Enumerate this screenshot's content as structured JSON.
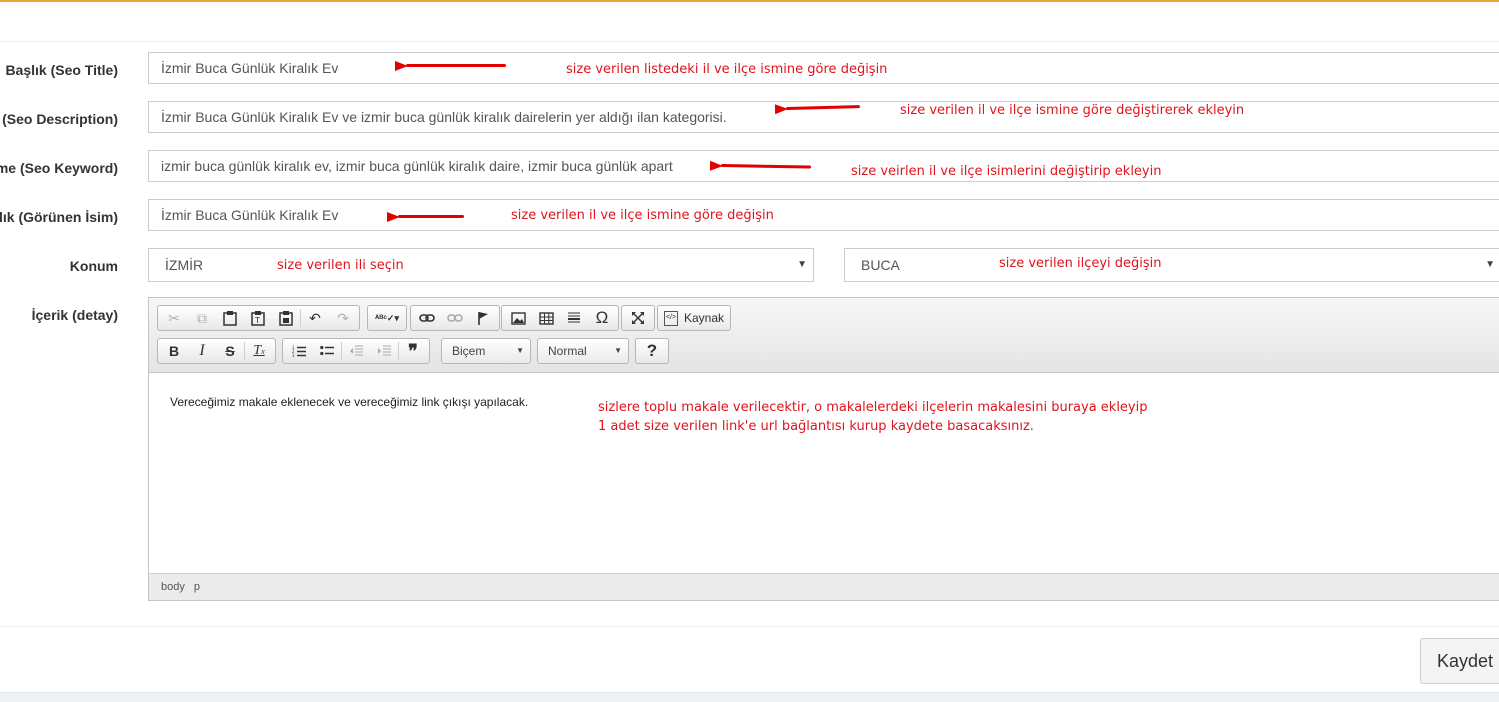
{
  "fields": {
    "seo_title": {
      "label": "Başlık (Seo Title)",
      "value": "İzmir Buca Günlük Kiralık Ev",
      "note": "size verilen listedeki il ve ilçe ismine göre değişin"
    },
    "seo_description": {
      "label": "(Seo Description)",
      "value": "İzmir Buca Günlük Kiralık Ev ve izmir buca günlük kiralık dairelerin yer aldığı ilan kategorisi.",
      "note": "size verilen il ve ilçe ismine göre değiştirerek ekleyin"
    },
    "seo_keyword": {
      "label": "me (Seo Keyword)",
      "value": "izmir buca günlük kiralık ev, izmir buca günlük kiralık daire, izmir buca günlük apart",
      "note": "size veirlen il ve ilçe isimlerini değiştirip ekleyin"
    },
    "display_name": {
      "label": "lık (Görünen İsim)",
      "value": "İzmir Buca Günlük Kiralık Ev",
      "note": "size verilen il ve ilçe ismine göre değişin"
    },
    "location": {
      "label": "Konum",
      "city": "İZMİR",
      "city_note": "size verilen ili seçin",
      "district": "BUCA",
      "district_note": "size verilen ilçeyi değişin"
    },
    "content": {
      "label": "İçerik (detay)"
    }
  },
  "editor": {
    "source_label": "Kaynak",
    "format_label": "Biçem",
    "paragraph_label": "Normal",
    "help_label": "?",
    "body_text": "Vereceğimiz makale eklenecek ve vereceğimiz link çıkışı yapılacak.",
    "note_line1": "sizlere toplu makale verilecektir, o makalelerdeki ilçelerin makalesini buraya ekleyip",
    "note_line2": "1 adet size verilen link'e url bağlantısı kurup kaydete basacaksınız.",
    "path": [
      "body",
      "p"
    ]
  },
  "actions": {
    "save_label": "Kaydet"
  },
  "colors": {
    "accent_top": "#e8a33d",
    "annotation": "#e0141c"
  },
  "icons": {
    "toolbar_row1": [
      "cut-icon",
      "copy-icon",
      "paste-icon",
      "paste-text-icon",
      "paste-word-icon",
      "undo-icon",
      "redo-icon",
      "spellcheck-icon",
      "link-icon",
      "unlink-icon",
      "anchor-icon",
      "image-icon",
      "table-icon",
      "horizontal-rule-icon",
      "special-char-icon",
      "maximize-icon",
      "source-icon"
    ],
    "toolbar_row2": [
      "bold-icon",
      "italic-icon",
      "strike-icon",
      "remove-format-icon",
      "numbered-list-icon",
      "bullet-list-icon",
      "outdent-icon",
      "indent-icon",
      "blockquote-icon"
    ]
  }
}
